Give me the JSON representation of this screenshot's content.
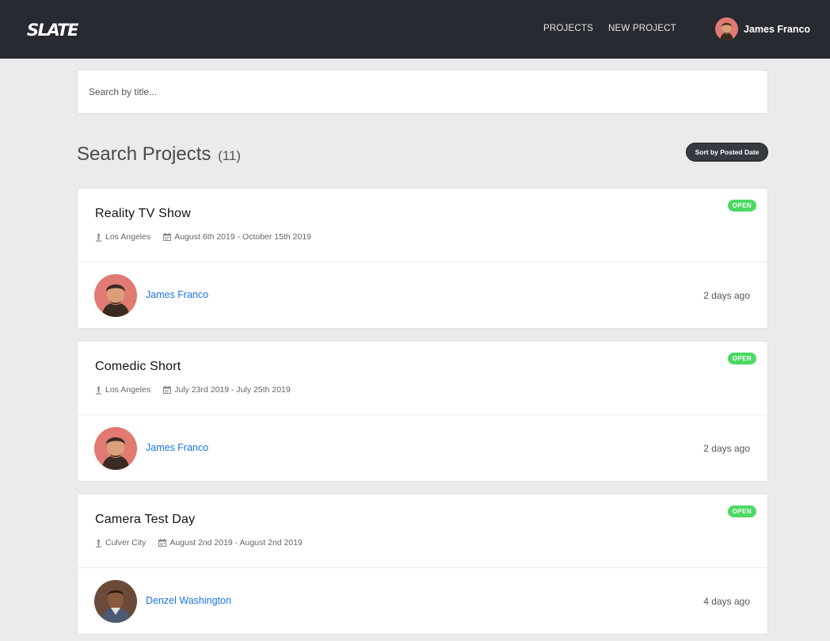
{
  "header": {
    "logo": "SLATE",
    "nav": {
      "projects": "PROJECTS",
      "new_project": "NEW PROJECT"
    },
    "user": {
      "name": "James Franco"
    }
  },
  "search": {
    "placeholder": "Search by title..."
  },
  "page": {
    "title": "Search Projects",
    "count": "(11)",
    "sort_label": "Sort by Posted Date"
  },
  "projects": [
    {
      "title": "Reality TV Show",
      "location": "Los Angeles",
      "dates": "August 6th 2019 - October 15th 2019",
      "status": "OPEN",
      "author": "James Franco",
      "posted": "2 days ago"
    },
    {
      "title": "Comedic Short",
      "location": "Los Angeles",
      "dates": "July 23rd 2019 - July 25th 2019",
      "status": "OPEN",
      "author": "James Franco",
      "posted": "2 days ago"
    },
    {
      "title": "Camera Test Day",
      "location": "Culver City",
      "dates": "August 2nd 2019 - August 2nd 2019",
      "status": "OPEN",
      "author": "Denzel Washington",
      "posted": "4 days ago"
    }
  ],
  "colors": {
    "header_bg": "#272a31",
    "page_bg": "#ebebeb",
    "link": "#1a73e8",
    "open_badge": "#4cd964",
    "sort_button": "#343a40"
  }
}
